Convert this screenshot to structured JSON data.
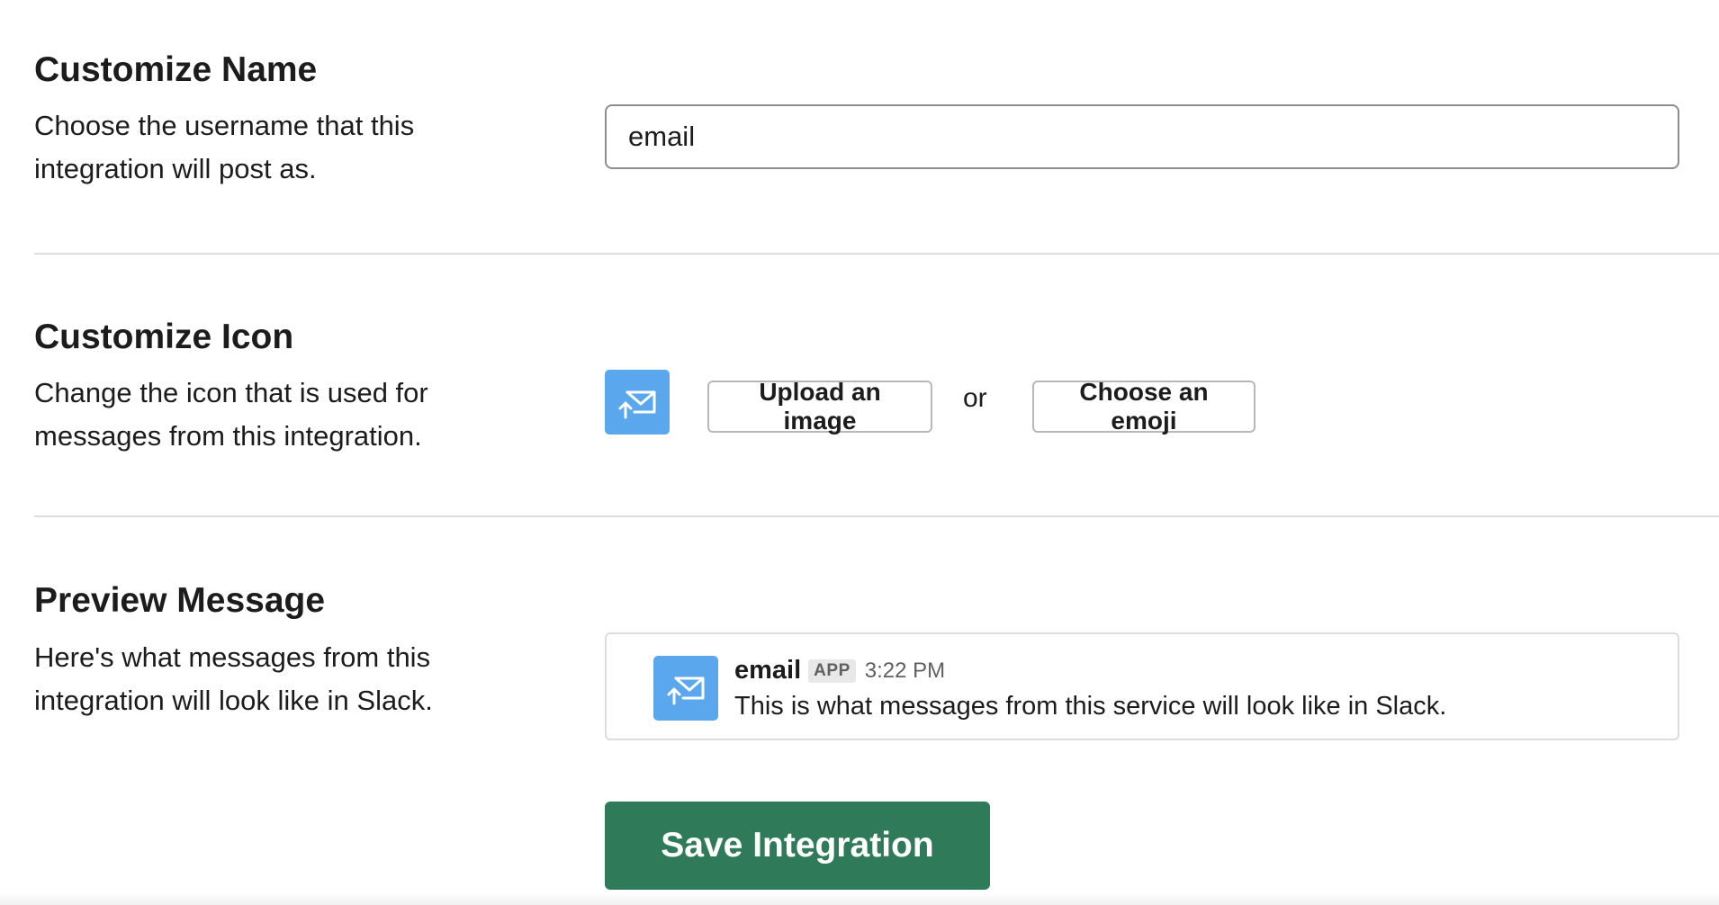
{
  "customize_name": {
    "title": "Customize Name",
    "description": "Choose the username that this integration will post as.",
    "input_value": "email"
  },
  "customize_icon": {
    "title": "Customize Icon",
    "description": "Change the icon that is used for messages from this integration.",
    "icon": "email-forward-icon",
    "upload_label": "Upload an image",
    "or_label": "or",
    "emoji_label": "Choose an emoji"
  },
  "preview_message": {
    "title": "Preview Message",
    "description": "Here's what messages from this integration will look like in Slack.",
    "sender_name": "email",
    "badge": "APP",
    "time": "3:22 PM",
    "text": "This is what messages from this service will look like in Slack."
  },
  "save_label": "Save Integration",
  "colors": {
    "icon_bg": "#5aa7ee",
    "save_button": "#2f7a59",
    "divider": "#dddddd"
  }
}
